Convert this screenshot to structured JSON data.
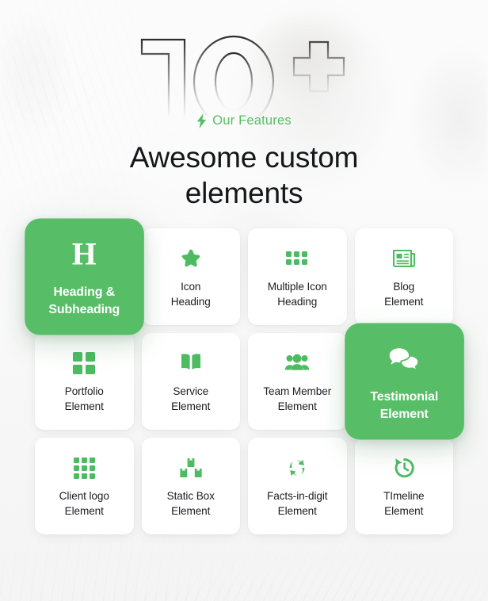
{
  "hero": {
    "big_number": "10",
    "big_number_suffix": "+",
    "eyebrow_icon": "lightning-bolt-icon",
    "eyebrow": "Our Features",
    "title_line1": "Awesome custom",
    "title_line2": "elements"
  },
  "colors": {
    "accent_green": "#57be67",
    "icon_green": "#4cbb62",
    "card_bg": "#ffffff",
    "page_bg": "#f4f4f4",
    "title_text": "#15161a"
  },
  "cards": [
    {
      "id": "heading-subheading",
      "icon": "letter-h-serif-icon",
      "label_line1": "Heading &",
      "label_line2": "Subheading",
      "active": true
    },
    {
      "id": "icon-heading",
      "icon": "star-icon",
      "label_line1": "Icon",
      "label_line2": "Heading",
      "active": false
    },
    {
      "id": "multiple-icon-heading",
      "icon": "grid-3x2-icon",
      "label_line1": "Multiple Icon",
      "label_line2": "Heading",
      "active": false
    },
    {
      "id": "blog-element",
      "icon": "newspaper-icon",
      "label_line1": "Blog",
      "label_line2": "Element",
      "active": false
    },
    {
      "id": "portfolio-element",
      "icon": "grid-2x2-icon",
      "label_line1": "Portfolio",
      "label_line2": "Element",
      "active": false
    },
    {
      "id": "service-element",
      "icon": "open-book-icon",
      "label_line1": "Service",
      "label_line2": "Element",
      "active": false
    },
    {
      "id": "team-member-element",
      "icon": "people-group-icon",
      "label_line1": "Team Member",
      "label_line2": "Element",
      "active": false
    },
    {
      "id": "testimonial-element",
      "icon": "speech-bubbles-icon",
      "label_line1": "Testimonial",
      "label_line2": "Element",
      "active": true
    },
    {
      "id": "client-logo-element",
      "icon": "grid-3x3-icon",
      "label_line1": "Client logo",
      "label_line2": "Element",
      "active": false
    },
    {
      "id": "static-box-element",
      "icon": "stacked-boxes-icon",
      "label_line1": "Static Box",
      "label_line2": "Element",
      "active": false
    },
    {
      "id": "facts-in-digit-element",
      "icon": "sync-arrows-icon",
      "label_line1": "Facts-in-digit",
      "label_line2": "Element",
      "active": false
    },
    {
      "id": "timeline-element",
      "icon": "clock-rewind-icon",
      "label_line1": "TImeline",
      "label_line2": "Element",
      "active": false
    }
  ]
}
